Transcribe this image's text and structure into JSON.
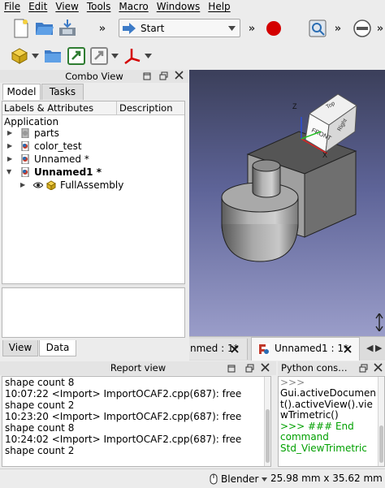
{
  "menubar": {
    "items": [
      "File",
      "Edit",
      "View",
      "Tools",
      "Macro",
      "Windows",
      "Help"
    ]
  },
  "toolbar": {
    "workbench": "Start",
    "overflow": "»"
  },
  "combo_view": {
    "title": "Combo View",
    "tabs": [
      "Model",
      "Tasks"
    ],
    "tree_headers": [
      "Labels & Attributes",
      "Description"
    ],
    "root": "Application",
    "items": [
      "parts",
      "color_test",
      "Unnamed *",
      "Unnamed1 *",
      "FullAssembly"
    ],
    "bottom_tabs": [
      "View",
      "Data"
    ]
  },
  "view3d": {
    "cube_faces": [
      "Top",
      "FRONT",
      "Right"
    ],
    "axes": [
      "Z",
      "X",
      "Y"
    ]
  },
  "doc_tabs": [
    "nmed : 1*",
    "Unnamed1 : 1*"
  ],
  "report_view": {
    "title": "Report view",
    "lines": [
      "shape count 8",
      "10:07:22  <Import> ImportOCAF2.cpp(687): free",
      "shape count 2",
      "10:23:20  <Import> ImportOCAF2.cpp(687): free",
      "shape count 8",
      "10:24:02  <Import> ImportOCAF2.cpp(687): free",
      "shape count 2"
    ]
  },
  "python_console": {
    "title": "Python cons…",
    "lines": [
      ">>> ",
      "Gui.activeDocumen",
      "t().activeView().vie",
      "wTrimetric()",
      ">>> ### End",
      "command",
      "Std_ViewTrimetric"
    ]
  },
  "statusbar": {
    "nav_style": "Blender",
    "dimensions": "25.98 mm x 35.62 mm"
  },
  "colors": {
    "macro_record": "#d40000",
    "python_comment": "#00a000",
    "accent": "#3daee9"
  }
}
